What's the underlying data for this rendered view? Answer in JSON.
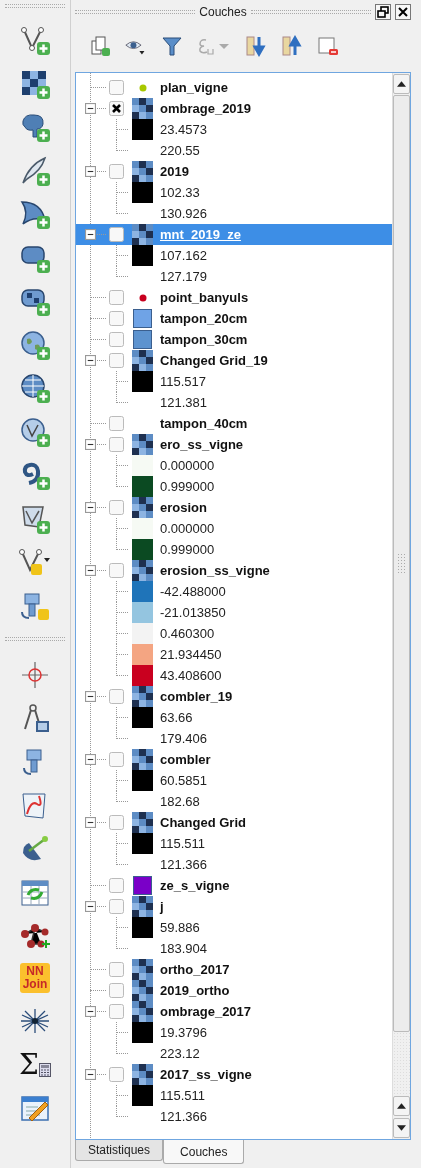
{
  "toolbox": {
    "join_label": [
      "NN",
      "Join"
    ],
    "sum_sign": "Σ"
  },
  "panel": {
    "title": "Couches"
  },
  "layers": [
    {
      "name": "plan_vigne",
      "kind": "point",
      "color": "#a8c800",
      "checked": false,
      "selected": false
    },
    {
      "name": "ombrage_2019",
      "kind": "raster",
      "checked": true,
      "selected": false,
      "expanded": true,
      "legend": [
        {
          "label": "23.4573",
          "color": "#000000"
        },
        {
          "label": "220.55"
        }
      ]
    },
    {
      "name": "2019",
      "kind": "raster",
      "checked": false,
      "selected": false,
      "expanded": true,
      "legend": [
        {
          "label": "102.33",
          "color": "#000000"
        },
        {
          "label": "130.926"
        }
      ]
    },
    {
      "name": "mnt_2019_ze",
      "kind": "raster",
      "checked": false,
      "selected": true,
      "expanded": true,
      "legend": [
        {
          "label": "107.162",
          "color": "#000000"
        },
        {
          "label": "127.179"
        }
      ]
    },
    {
      "name": "point_banyuls",
      "kind": "point",
      "color": "#c8001e",
      "checked": false,
      "selected": false
    },
    {
      "name": "tampon_20cm",
      "kind": "fill",
      "color": "#6fa3e6",
      "checked": false,
      "selected": false
    },
    {
      "name": "tampon_30cm",
      "kind": "fill",
      "color": "#5d93cf",
      "checked": false,
      "selected": false
    },
    {
      "name": "Changed Grid_19",
      "kind": "raster",
      "checked": false,
      "selected": false,
      "expanded": true,
      "legend": [
        {
          "label": "115.517",
          "color": "#000000"
        },
        {
          "label": "121.381"
        }
      ]
    },
    {
      "name": "tampon_40cm",
      "kind": "none",
      "checked": false,
      "selected": false
    },
    {
      "name": "ero_ss_vigne",
      "kind": "raster",
      "checked": false,
      "selected": false,
      "expanded": true,
      "legend": [
        {
          "label": "0.000000",
          "color": "#f6faf4"
        },
        {
          "label": "0.999000",
          "color": "#0b4a22"
        }
      ]
    },
    {
      "name": "erosion",
      "kind": "raster",
      "checked": false,
      "selected": false,
      "expanded": true,
      "legend": [
        {
          "label": "0.000000",
          "color": "#f6faf4"
        },
        {
          "label": "0.999000",
          "color": "#0b4a22"
        }
      ]
    },
    {
      "name": "erosion_ss_vigne",
      "kind": "raster",
      "checked": false,
      "selected": false,
      "expanded": true,
      "legend": [
        {
          "label": "-42.488000",
          "color": "#1f74b9"
        },
        {
          "label": "-21.013850",
          "color": "#94c5e0"
        },
        {
          "label": "0.460300",
          "color": "#f3f3f3"
        },
        {
          "label": "21.934450",
          "color": "#f4a582"
        },
        {
          "label": "43.408600",
          "color": "#c9001f"
        }
      ]
    },
    {
      "name": "combler_19",
      "kind": "raster",
      "checked": false,
      "selected": false,
      "expanded": true,
      "legend": [
        {
          "label": "63.66",
          "color": "#000000"
        },
        {
          "label": "179.406"
        }
      ]
    },
    {
      "name": "combler",
      "kind": "raster",
      "checked": false,
      "selected": false,
      "expanded": true,
      "legend": [
        {
          "label": "60.5851",
          "color": "#000000"
        },
        {
          "label": "182.68"
        }
      ]
    },
    {
      "name": "Changed Grid",
      "kind": "raster",
      "checked": false,
      "selected": false,
      "expanded": true,
      "legend": [
        {
          "label": "115.511",
          "color": "#000000"
        },
        {
          "label": "121.366"
        }
      ]
    },
    {
      "name": "ze_s_vigne",
      "kind": "fill",
      "color": "#7a00c8",
      "checked": false,
      "selected": false
    },
    {
      "name": "j",
      "kind": "raster",
      "checked": false,
      "selected": false,
      "expanded": true,
      "legend": [
        {
          "label": "59.886",
          "color": "#000000"
        },
        {
          "label": "183.904"
        }
      ]
    },
    {
      "name": "ortho_2017",
      "kind": "raster",
      "checked": false,
      "selected": false
    },
    {
      "name": "2019_ortho",
      "kind": "raster",
      "checked": false,
      "selected": false
    },
    {
      "name": "ombrage_2017",
      "kind": "raster",
      "checked": false,
      "selected": false,
      "expanded": true,
      "legend": [
        {
          "label": "19.3796",
          "color": "#000000"
        },
        {
          "label": "223.12"
        }
      ]
    },
    {
      "name": "2017_ss_vigne",
      "kind": "raster",
      "checked": false,
      "selected": false,
      "expanded": true,
      "legend": [
        {
          "label": "115.511",
          "color": "#000000"
        },
        {
          "label": "121.366"
        }
      ]
    }
  ],
  "tabs": [
    {
      "label": "Statistiques",
      "selected": false
    },
    {
      "label": "Couches",
      "selected": true
    }
  ]
}
